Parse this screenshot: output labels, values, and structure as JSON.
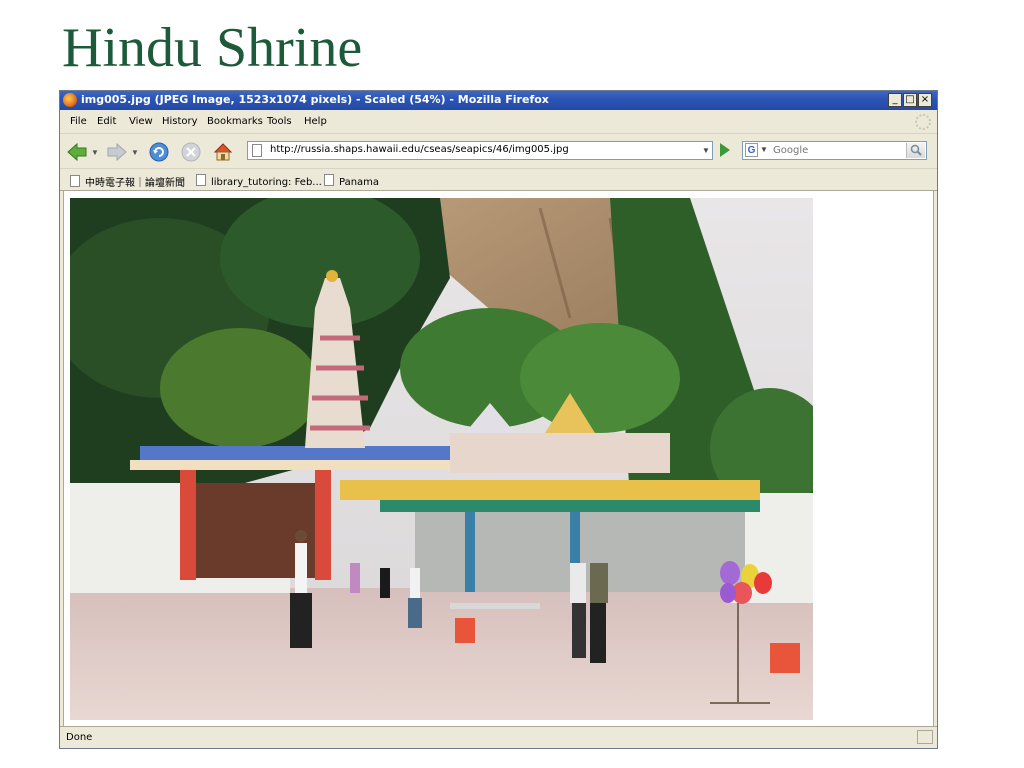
{
  "slide": {
    "title": "Hindu Shrine"
  },
  "window": {
    "title": "img005.jpg (JPEG Image, 1523x1074 pixels) - Scaled (54%) - Mozilla Firefox",
    "controls": {
      "minimize": "_",
      "maximize": "□",
      "close": "×"
    }
  },
  "menu": {
    "items": [
      "File",
      "Edit",
      "View",
      "History",
      "Bookmarks",
      "Tools",
      "Help"
    ]
  },
  "navbar": {
    "url": "http://russia.shaps.hawaii.edu/cseas/seapics/46/img005.jpg",
    "search_engine": "G",
    "search_placeholder": "Google"
  },
  "bookmarks": {
    "items": [
      "中時電子報｜論壇新聞",
      "library_tutoring: Feb...",
      "Panama"
    ]
  },
  "status": {
    "text": "Done"
  },
  "colors": {
    "title_green": "#1d5a3a",
    "titlebar_blue": "#2c55b5",
    "chrome": "#ece9d8"
  }
}
